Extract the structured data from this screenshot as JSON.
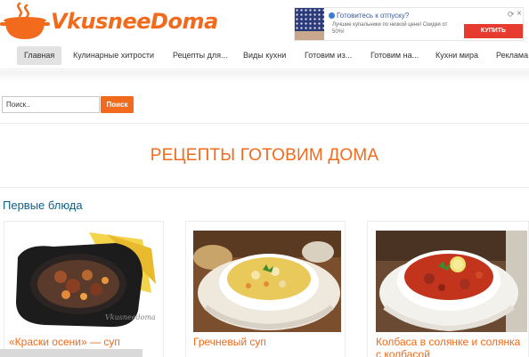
{
  "site": {
    "logo_text": "VkusneeDoma",
    "colors": {
      "brand_orange": "#f26a1b",
      "section_blue": "#0f5f8a",
      "ad_red": "#e63b2e"
    }
  },
  "ad": {
    "title": "Готовитесь к отпуску?",
    "description": "Лучшие купальники по низкой цене! Скидки от 50%!",
    "button_label": "КУПИТЬ",
    "refresh_icon": "refresh-icon",
    "close_icon": "close-icon"
  },
  "nav": {
    "items": [
      {
        "label": "Главная",
        "active": true
      },
      {
        "label": "Кулинарные хитрости"
      },
      {
        "label": "Рецепты для..."
      },
      {
        "label": "Виды кухни"
      },
      {
        "label": "Готовим из..."
      },
      {
        "label": "Готовим на..."
      },
      {
        "label": "Кухни мира"
      },
      {
        "label": "Реклама"
      }
    ]
  },
  "search": {
    "placeholder": "Поиск..",
    "button_label": "Поиск"
  },
  "main": {
    "page_title": "РЕЦЕПТЫ ГОТОВИМ ДОМА",
    "section_title": "Первые блюда",
    "cards": [
      {
        "title": "«Краски осени» — суп",
        "image_icon": "soup-bowl-image"
      },
      {
        "title": "Гречневый суп",
        "image_icon": "buckwheat-soup-image"
      },
      {
        "title": "Колбаса в солянке и солянка с колбасой",
        "image_icon": "solyanka-image"
      }
    ]
  }
}
